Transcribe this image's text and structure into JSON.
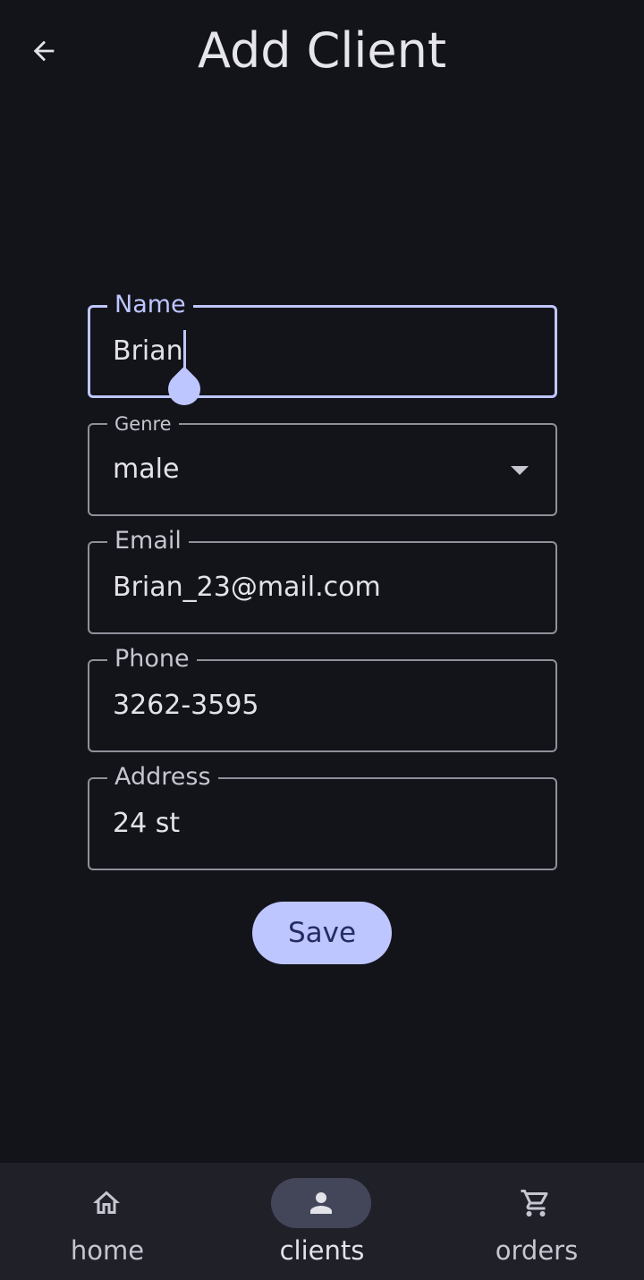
{
  "header": {
    "title": "Add Client",
    "back_icon": "arrow-back-icon"
  },
  "form": {
    "name": {
      "label": "Name",
      "value": "Brian"
    },
    "genre": {
      "label": "Genre",
      "value": "male",
      "icon": "dropdown-arrow-icon"
    },
    "email": {
      "label": "Email",
      "value": "Brian_23@mail.com"
    },
    "phone": {
      "label": "Phone",
      "value": "3262-3595"
    },
    "address": {
      "label": "Address",
      "value": "24 st"
    },
    "save_label": "Save"
  },
  "bottom_nav": {
    "items": [
      {
        "label": "home",
        "icon": "home-icon",
        "active": false
      },
      {
        "label": "clients",
        "icon": "person-icon",
        "active": true
      },
      {
        "label": "orders",
        "icon": "shopping-cart-icon",
        "active": false
      }
    ]
  },
  "colors": {
    "background": "#13141a",
    "accent": "#bec6ff",
    "nav_background": "#1f2028",
    "nav_active_pill": "#434659"
  }
}
